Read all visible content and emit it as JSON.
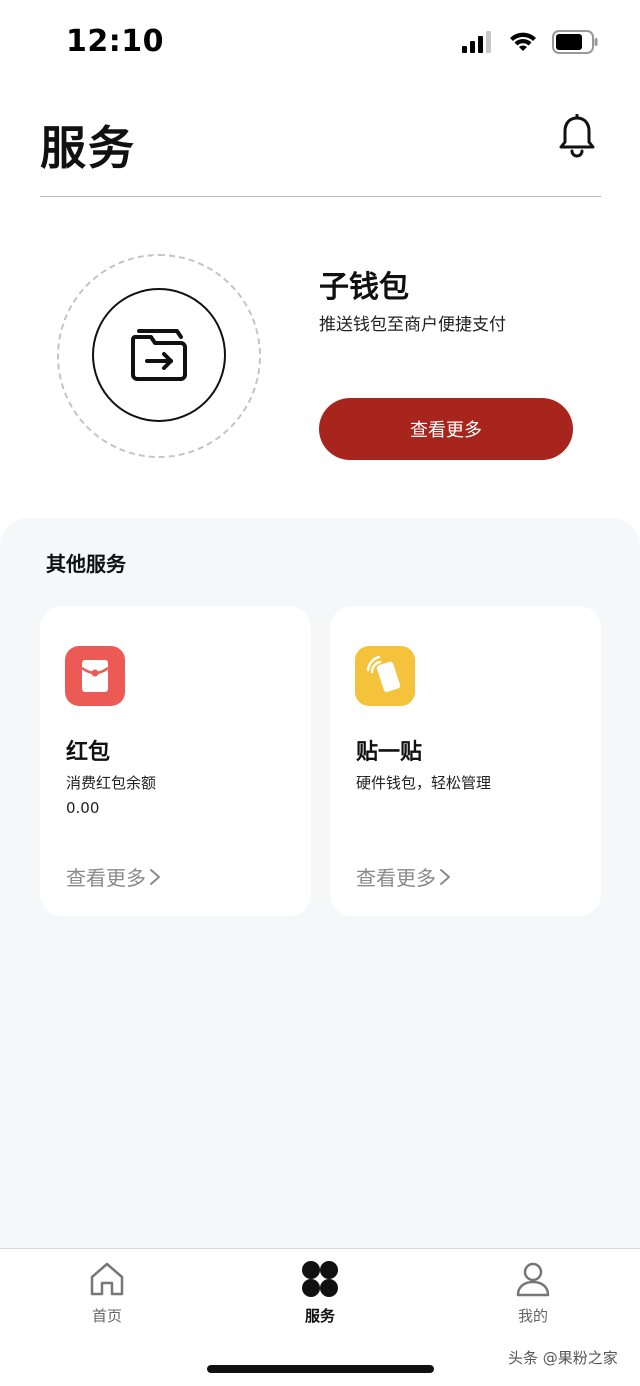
{
  "status_bar": {
    "time": "12:10",
    "icons": [
      "signal-icon",
      "wifi-icon",
      "battery-icon"
    ]
  },
  "header": {
    "title": "服务",
    "bell_icon": "bell-icon"
  },
  "sub_wallet": {
    "icon": "wallet-transfer-icon",
    "title": "子钱包",
    "subtitle": "推送钱包至商户便捷支付",
    "button_label": "查看更多",
    "button_color": "#a7251c"
  },
  "other_services": {
    "title": "其他服务",
    "cards": [
      {
        "icon": "red-packet-icon",
        "icon_color": "#ec5a55",
        "title": "红包",
        "description": "消费红包余额",
        "value": "0.00",
        "more_label": "查看更多"
      },
      {
        "icon": "tap-phone-icon",
        "icon_color": "#f5c33b",
        "title": "贴一贴",
        "description": "硬件钱包，轻松管理",
        "more_label": "查看更多"
      }
    ]
  },
  "tabbar": {
    "tabs": [
      {
        "label": "首页",
        "icon": "home-icon",
        "active": false
      },
      {
        "label": "服务",
        "icon": "clover-grid-icon",
        "active": true
      },
      {
        "label": "我的",
        "icon": "user-icon",
        "active": false
      }
    ]
  },
  "watermark": "头条 @果粉之家"
}
